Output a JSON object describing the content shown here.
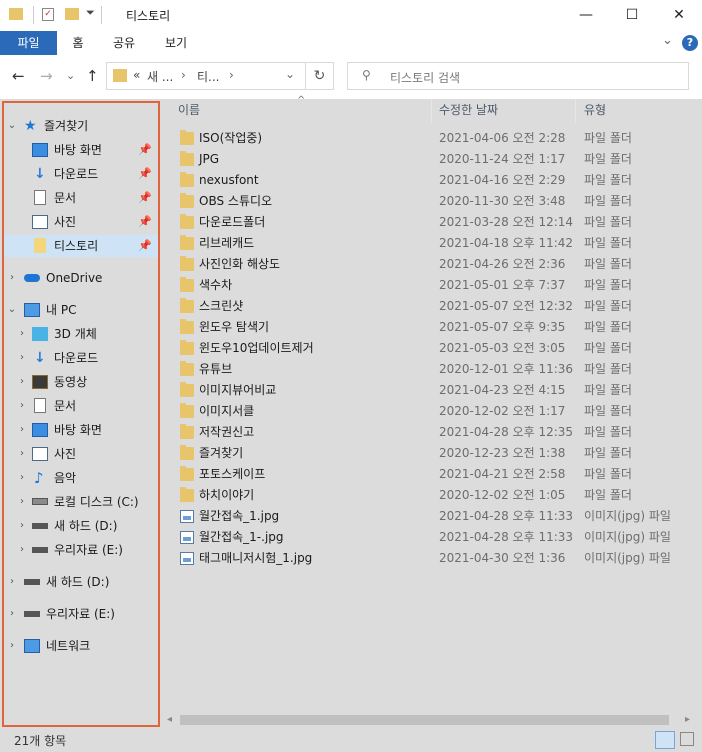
{
  "window": {
    "title": "티스토리",
    "controls": {
      "minimize": "—",
      "maximize": "☐",
      "close": "✕"
    }
  },
  "ribbon": {
    "tabs": [
      "파일",
      "홈",
      "공유",
      "보기"
    ],
    "collapse": "⌄",
    "help": "?"
  },
  "address": {
    "back": "←",
    "forward": "→",
    "recent": "⌄",
    "up": "↑",
    "crumbs": [
      "«",
      "새 ...",
      "›",
      "티...",
      "›"
    ],
    "dropdown": "⌄",
    "refresh": "↻",
    "search_placeholder": "티스토리 검색"
  },
  "nav": {
    "quick_access": "즐겨찾기",
    "quick_items": [
      {
        "label": "바탕 화면",
        "icon": "desktop-icon"
      },
      {
        "label": "다운로드",
        "icon": "download-icon"
      },
      {
        "label": "문서",
        "icon": "document-icon"
      },
      {
        "label": "사진",
        "icon": "pictures-icon"
      },
      {
        "label": "티스토리",
        "icon": "folder-icon",
        "selected": true
      }
    ],
    "onedrive": "OneDrive",
    "this_pc": "내 PC",
    "pc_items": [
      {
        "label": "3D 개체",
        "icon": "3d-objects-icon"
      },
      {
        "label": "다운로드",
        "icon": "download-icon"
      },
      {
        "label": "동영상",
        "icon": "video-icon"
      },
      {
        "label": "문서",
        "icon": "document-icon"
      },
      {
        "label": "바탕 화면",
        "icon": "desktop-icon"
      },
      {
        "label": "사진",
        "icon": "pictures-icon"
      },
      {
        "label": "음악",
        "icon": "music-icon"
      },
      {
        "label": "로컬 디스크 (C:)",
        "icon": "local-disk-icon"
      },
      {
        "label": "새 하드 (D:)",
        "icon": "drive-icon"
      },
      {
        "label": "우리자료 (E:)",
        "icon": "drive-icon"
      }
    ],
    "drives": [
      {
        "label": "새 하드 (D:)",
        "icon": "drive-icon"
      },
      {
        "label": "우리자료 (E:)",
        "icon": "drive-icon"
      }
    ],
    "network": "네트워크"
  },
  "columns": {
    "name": "이름",
    "date": "수정한 날짜",
    "type": "유형",
    "sort_indicator": "^"
  },
  "files": [
    {
      "name": "ISO(작업중)",
      "date": "2021-04-06 오전 2:28",
      "type": "파일 폴더",
      "kind": "folder"
    },
    {
      "name": "JPG",
      "date": "2020-11-24 오전 1:17",
      "type": "파일 폴더",
      "kind": "folder"
    },
    {
      "name": "nexusfont",
      "date": "2021-04-16 오전 2:29",
      "type": "파일 폴더",
      "kind": "folder"
    },
    {
      "name": "OBS 스튜디오",
      "date": "2020-11-30 오전 3:48",
      "type": "파일 폴더",
      "kind": "folder"
    },
    {
      "name": "다운로드폴더",
      "date": "2021-03-28 오전 12:14",
      "type": "파일 폴더",
      "kind": "folder"
    },
    {
      "name": "리브레캐드",
      "date": "2021-04-18 오후 11:42",
      "type": "파일 폴더",
      "kind": "folder"
    },
    {
      "name": "사진인화 해상도",
      "date": "2021-04-26 오전 2:36",
      "type": "파일 폴더",
      "kind": "folder"
    },
    {
      "name": "색수차",
      "date": "2021-05-01 오후 7:37",
      "type": "파일 폴더",
      "kind": "folder"
    },
    {
      "name": "스크린샷",
      "date": "2021-05-07 오전 12:32",
      "type": "파일 폴더",
      "kind": "folder"
    },
    {
      "name": "윈도우 탐색기",
      "date": "2021-05-07 오후 9:35",
      "type": "파일 폴더",
      "kind": "folder"
    },
    {
      "name": "윈도우10업데이트제거",
      "date": "2021-05-03 오전 3:05",
      "type": "파일 폴더",
      "kind": "folder"
    },
    {
      "name": "유튜브",
      "date": "2020-12-01 오후 11:36",
      "type": "파일 폴더",
      "kind": "folder"
    },
    {
      "name": "이미지뷰어비교",
      "date": "2021-04-23 오전 4:15",
      "type": "파일 폴더",
      "kind": "folder"
    },
    {
      "name": "이미지서클",
      "date": "2020-12-02 오전 1:17",
      "type": "파일 폴더",
      "kind": "folder"
    },
    {
      "name": "저작권신고",
      "date": "2021-04-28 오후 12:35",
      "type": "파일 폴더",
      "kind": "folder"
    },
    {
      "name": "즐겨찾기",
      "date": "2020-12-23 오전 1:38",
      "type": "파일 폴더",
      "kind": "folder"
    },
    {
      "name": "포토스케이프",
      "date": "2021-04-21 오전 2:58",
      "type": "파일 폴더",
      "kind": "folder"
    },
    {
      "name": "하치이야기",
      "date": "2020-12-02 오전 1:05",
      "type": "파일 폴더",
      "kind": "folder"
    },
    {
      "name": "월간접속_1.jpg",
      "date": "2021-04-28 오후 11:33",
      "type": "이미지(jpg) 파일",
      "kind": "image"
    },
    {
      "name": "월간접속_1-.jpg",
      "date": "2021-04-28 오후 11:33",
      "type": "이미지(jpg) 파일",
      "kind": "image"
    },
    {
      "name": "태그매니저시험_1.jpg",
      "date": "2021-04-30 오전 1:36",
      "type": "이미지(jpg) 파일",
      "kind": "image"
    }
  ],
  "status": {
    "count": "21개 항목"
  },
  "colors": {
    "accent": "#2b6ab8",
    "nav_border": "#e0643c",
    "folder": "#e8c46a",
    "selection": "#cfe3f7"
  }
}
